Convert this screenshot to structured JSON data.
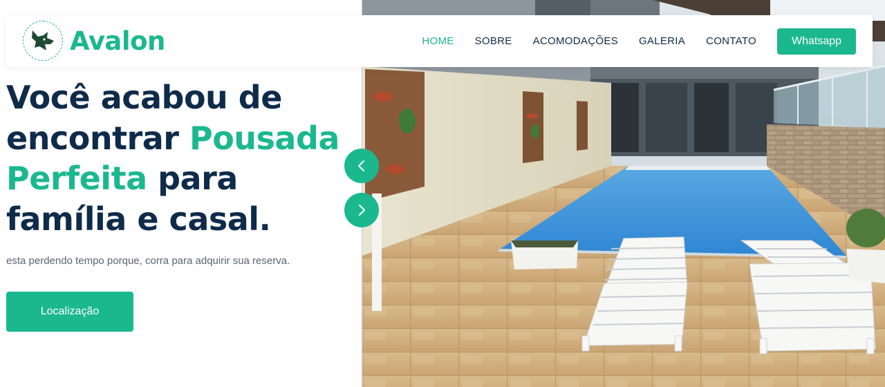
{
  "brand": {
    "name": "Avalon",
    "logo_icon": "wolf-head-icon"
  },
  "nav": {
    "items": [
      {
        "label": "HOME",
        "active": true
      },
      {
        "label": "SOBRE",
        "active": false
      },
      {
        "label": "ACOMODAÇÕES",
        "active": false
      },
      {
        "label": "GALERIA",
        "active": false
      },
      {
        "label": "CONTATO",
        "active": false
      }
    ],
    "cta_label": "Whatsapp"
  },
  "hero": {
    "headline": {
      "part1": "Você acabou de encontrar ",
      "accent": "Pousada Perfeita",
      "part2": " para família e casal."
    },
    "subtitle": "esta perdendo tempo porque, corra para adquirir sua reserva.",
    "button_label": "Localização",
    "image": "pool-with-lounge-chairs"
  },
  "carousel": {
    "prev_icon": "chevron-left-icon",
    "next_icon": "chevron-right-icon"
  },
  "colors": {
    "accent": "#1bb88f",
    "navy": "#0f2b4a",
    "text_muted": "#5a6470"
  }
}
